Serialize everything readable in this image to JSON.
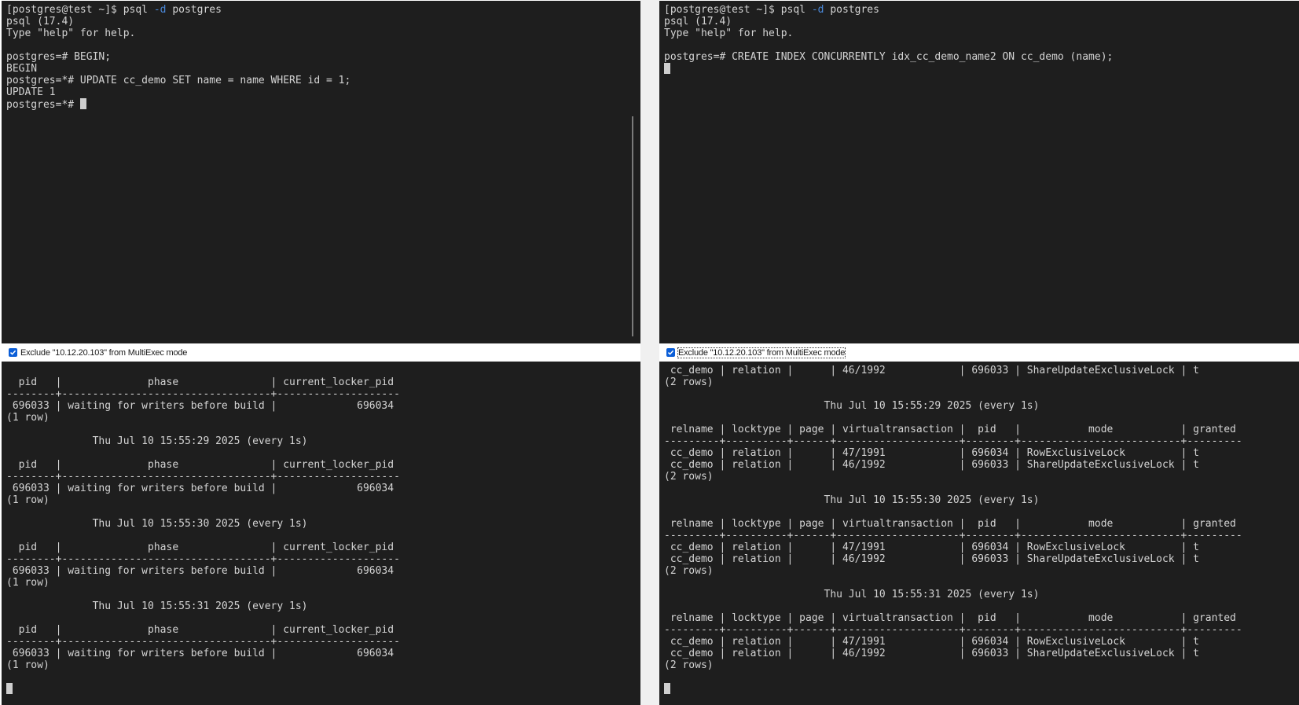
{
  "terminals": {
    "top_left": {
      "lines": [
        "[postgres@test ~]$ psql -d postgres",
        "psql (17.4)",
        "Type \"help\" for help.",
        "",
        "postgres=# BEGIN;",
        "BEGIN",
        "postgres=*# UPDATE cc_demo SET name = name WHERE id = 1;",
        "UPDATE 1"
      ],
      "prompt": "postgres=*# "
    },
    "top_right": {
      "lines": [
        "[postgres@test ~]$ psql -d postgres",
        "psql (17.4)",
        "Type \"help\" for help.",
        "",
        "postgres=# CREATE INDEX CONCURRENTLY idx_cc_demo_name2 ON cc_demo (name);"
      ]
    },
    "bottom_left": {
      "lines": [
        "  pid   |              phase               | current_locker_pid",
        "--------+----------------------------------+--------------------",
        " 696033 | waiting for writers before build |             696034",
        "(1 row)",
        "",
        "              Thu Jul 10 15:55:29 2025 (every 1s)",
        "",
        "  pid   |              phase               | current_locker_pid",
        "--------+----------------------------------+--------------------",
        " 696033 | waiting for writers before build |             696034",
        "(1 row)",
        "",
        "              Thu Jul 10 15:55:30 2025 (every 1s)",
        "",
        "  pid   |              phase               | current_locker_pid",
        "--------+----------------------------------+--------------------",
        " 696033 | waiting for writers before build |             696034",
        "(1 row)",
        "",
        "              Thu Jul 10 15:55:31 2025 (every 1s)",
        "",
        "  pid   |              phase               | current_locker_pid",
        "--------+----------------------------------+--------------------",
        " 696033 | waiting for writers before build |             696034",
        "(1 row)",
        ""
      ]
    },
    "bottom_right": {
      "lines": [
        " cc_demo | relation |      | 46/1992            | 696033 | ShareUpdateExclusiveLock | t",
        "(2 rows)",
        "",
        "                          Thu Jul 10 15:55:29 2025 (every 1s)",
        "",
        " relname | locktype | page | virtualtransaction |  pid   |           mode           | granted",
        "---------+----------+------+--------------------+--------+--------------------------+---------",
        " cc_demo | relation |      | 47/1991            | 696034 | RowExclusiveLock         | t",
        " cc_demo | relation |      | 46/1992            | 696033 | ShareUpdateExclusiveLock | t",
        "(2 rows)",
        "",
        "                          Thu Jul 10 15:55:30 2025 (every 1s)",
        "",
        " relname | locktype | page | virtualtransaction |  pid   |           mode           | granted",
        "---------+----------+------+--------------------+--------+--------------------------+---------",
        " cc_demo | relation |      | 47/1991            | 696034 | RowExclusiveLock         | t",
        " cc_demo | relation |      | 46/1992            | 696033 | ShareUpdateExclusiveLock | t",
        "(2 rows)",
        "",
        "                          Thu Jul 10 15:55:31 2025 (every 1s)",
        "",
        " relname | locktype | page | virtualtransaction |  pid   |           mode           | granted",
        "---------+----------+------+--------------------+--------+--------------------------+---------",
        " cc_demo | relation |      | 47/1991            | 696034 | RowExclusiveLock         | t",
        " cc_demo | relation |      | 46/1992            | 696033 | ShareUpdateExclusiveLock | t",
        "(2 rows)",
        ""
      ]
    }
  },
  "multiexec": {
    "left_label": "Exclude \"10.12.20.103\" from MultiExec mode",
    "right_label": "Exclude \"10.12.20.103\" from MultiExec mode",
    "left_checked": true,
    "right_checked": true
  },
  "colors": {
    "terminal_bg": "#1e1e1e",
    "terminal_fg": "#d4d4d4",
    "option_flag": "#4a88d8",
    "checkbox": "#0b5ed7"
  }
}
